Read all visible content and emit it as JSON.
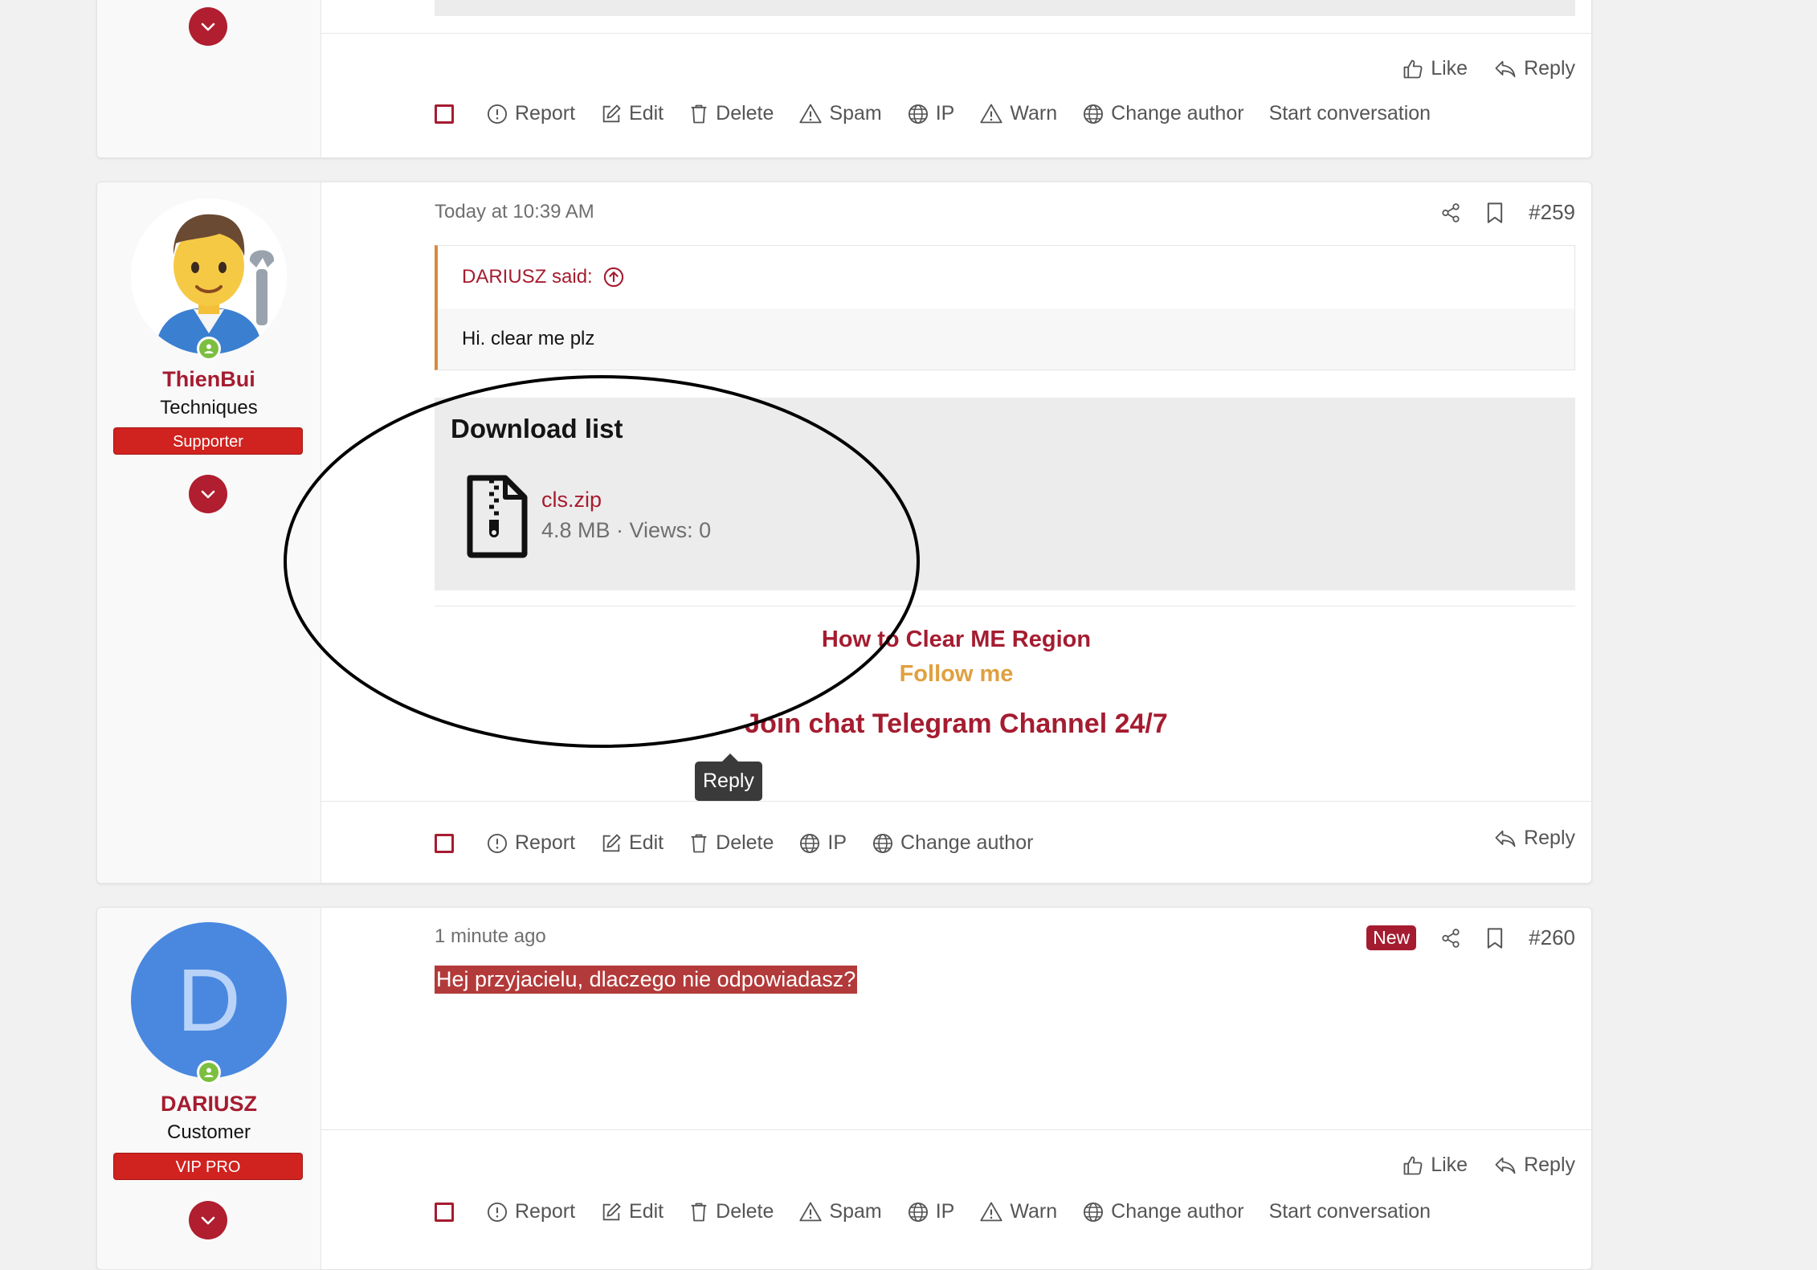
{
  "post_top": {
    "actions": {
      "like": "Like",
      "reply": "Reply",
      "report": "Report",
      "edit": "Edit",
      "delete": "Delete",
      "spam": "Spam",
      "ip": "IP",
      "warn": "Warn",
      "change_author": "Change author",
      "start_conversation": "Start conversation"
    }
  },
  "post_259": {
    "user": {
      "name": "ThienBui",
      "title": "Techniques",
      "banner": "Supporter"
    },
    "date": "Today at 10:39 AM",
    "number": "#259",
    "quote": {
      "author": "DARIUSZ said:",
      "text": "Hi. clear me plz"
    },
    "download": {
      "title": "Download list",
      "file_name": "cls.zip",
      "file_meta": "4.8 MB · Views: 0"
    },
    "signature": {
      "line1": "How to Clear ME Region",
      "line2": "Follow me",
      "line3": "Join chat Telegram Channel 24/7"
    },
    "tooltip": "Reply",
    "actions": {
      "report": "Report",
      "edit": "Edit",
      "delete": "Delete",
      "ip": "IP",
      "change_author": "Change author",
      "reply": "Reply"
    }
  },
  "post_260": {
    "user": {
      "name": "DARIUSZ",
      "initial": "D",
      "title": "Customer",
      "banner": "VIP PRO"
    },
    "date": "1 minute ago",
    "badge": "New",
    "number": "#260",
    "message": "Hej przyjacielu, dlaczego nie odpowiadasz?",
    "actions": {
      "like": "Like",
      "reply": "Reply",
      "report": "Report",
      "edit": "Edit",
      "delete": "Delete",
      "spam": "Spam",
      "ip": "IP",
      "warn": "Warn",
      "change_author": "Change author",
      "start_conversation": "Start conversation"
    }
  },
  "colors": {
    "accent": "#a51c30",
    "banner_red": "#d0221f",
    "follow_orange": "#e0a040",
    "avatar_blue": "#4a88e0",
    "online_green": "#7cbf40"
  }
}
